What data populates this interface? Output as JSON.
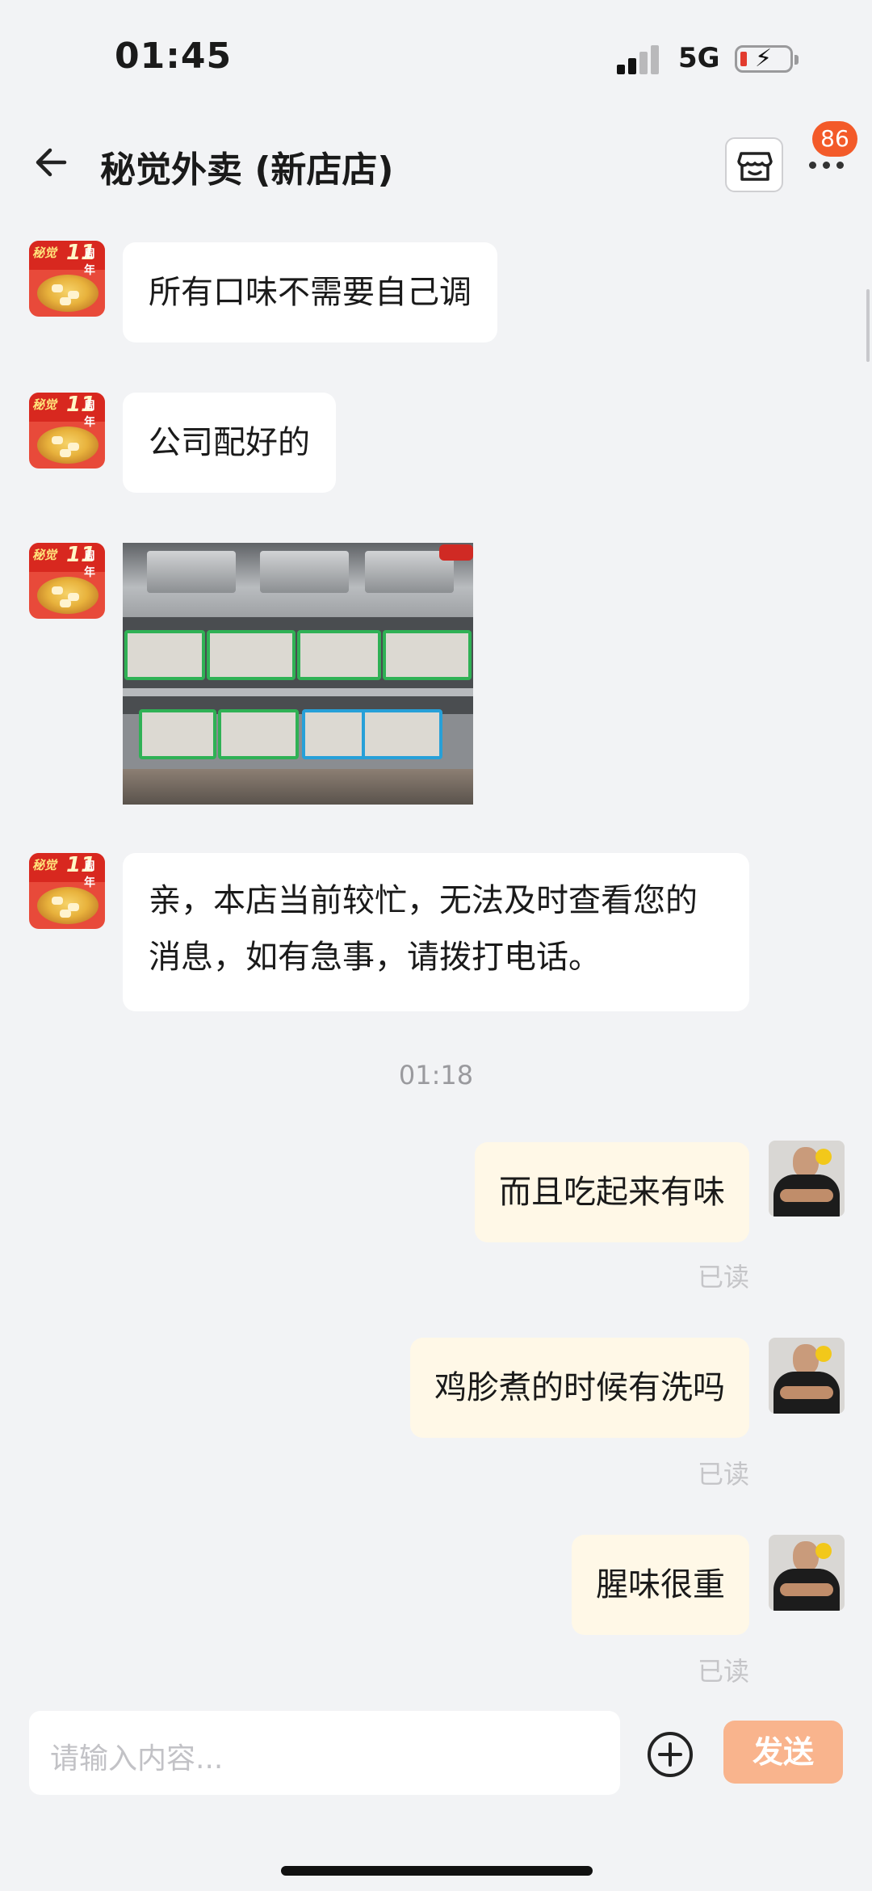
{
  "status_bar": {
    "time": "01:45",
    "network": "5G"
  },
  "header": {
    "title": "秘觉外卖 (新店店)",
    "badge_count": "86"
  },
  "shop_avatar": {
    "brand_text": "秘觉",
    "anniversary_number": "11",
    "anniversary_suffix": "周年"
  },
  "messages": {
    "m1": "所有口味不需要自己调",
    "m2": "公司配好的",
    "m4": "亲，本店当前较忙，无法及时查看您的消息，如有急事，请拨打电话。",
    "timestamp": "01:18",
    "r1": "而且吃起来有味",
    "r1_status": "已读",
    "r2": "鸡胗煮的时候有洗吗",
    "r2_status": "已读",
    "r3": "腥味很重",
    "r3_status": "已读"
  },
  "composer": {
    "placeholder": "请输入内容...",
    "send_label": "发送"
  },
  "colors": {
    "badge": "#f35a29",
    "send_button": "#f9b48d",
    "outgoing_bubble": "#fff8e7",
    "background": "#f2f3f5"
  }
}
